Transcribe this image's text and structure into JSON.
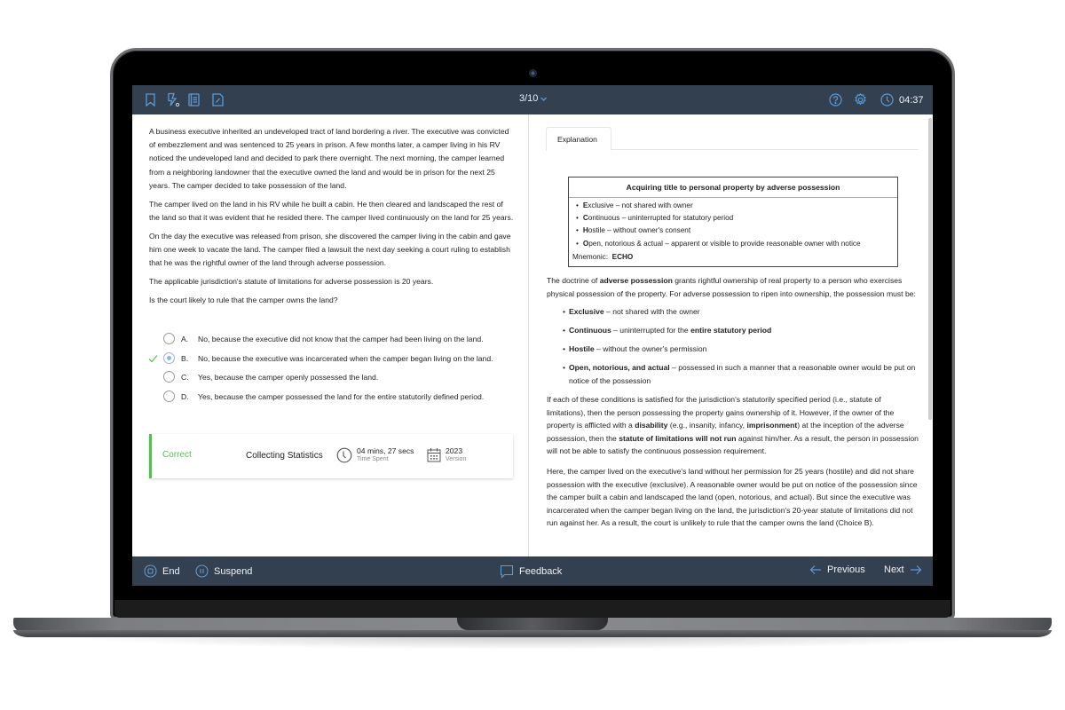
{
  "topbar": {
    "icons": [
      "bookmark-icon",
      "flashcard-icon",
      "notebook-icon",
      "notes-icon"
    ],
    "question_counter": "3/10",
    "timer": "04:37"
  },
  "question": {
    "stem": [
      "A business executive inherited an undeveloped tract of land bordering a river.  The executive was convicted of embezzlement and was sentenced to 25 years in prison.  A few months later, a camper living in his RV noticed the undeveloped land and decided to park there overnight.  The next morning, the camper learned from a neighboring landowner that the executive owned the land and would be in prison for the next 25 years.  The camper decided to take possession of the land.",
      "The camper lived on the land in his RV while he built a cabin.  He then cleared and landscaped the rest of the land so that it was evident that he resided there.  The camper lived continuously on the land for 25 years.",
      "On the day the executive was released from prison, she discovered the camper living in the cabin and gave him one week to vacate the land.  The camper filed a lawsuit the next day seeking a court ruling to establish that he was the rightful owner of the land through adverse possession.",
      "The applicable jurisdiction's statute of limitations for adverse possession is 20 years.",
      "Is the court likely to rule that the camper owns the land?"
    ],
    "choices": [
      {
        "letter": "A.",
        "text": "No, because the executive did not know that the camper had been living on the land.",
        "selected": false,
        "correct": false
      },
      {
        "letter": "B.",
        "text": "No, because the executive was incarcerated when the camper began living on the land.",
        "selected": true,
        "correct": true
      },
      {
        "letter": "C.",
        "text": "Yes, because the camper openly possessed the land.",
        "selected": false,
        "correct": false
      },
      {
        "letter": "D.",
        "text": "Yes, because the camper possessed the land for the entire statutorily defined period.",
        "selected": false,
        "correct": false
      }
    ]
  },
  "result": {
    "status": "Correct",
    "statistics": "Collecting Statistics",
    "time_spent_value": "04 mins, 27 secs",
    "time_spent_label": "Time Spent",
    "version_value": "2023",
    "version_label": "Version"
  },
  "explanation": {
    "tab_label": "Explanation",
    "box": {
      "title": "Acquiring title to personal property by adverse possession",
      "items": [
        {
          "initial": "E",
          "rest": "xclusive – not shared with owner"
        },
        {
          "initial": "C",
          "rest": "ontinuous – uninterrupted for statutory period"
        },
        {
          "initial": "H",
          "rest": "ostile – without owner's consent"
        },
        {
          "initial": "O",
          "rest": "pen, notorious & actual – apparent or visible to provide reasonable owner with notice"
        }
      ],
      "mnemonic_label": "Mnemonic:",
      "mnemonic_value": "ECHO"
    },
    "intro": {
      "before": "The doctrine of ",
      "bold": "adverse possession",
      "after": " grants rightful ownership of real property to a person who exercises physical possession of the property.  For adverse possession to ripen into ownership, the possession must be:"
    },
    "elements": [
      {
        "term": "Exclusive",
        "desc": " – not shared with the owner",
        "bold_tail": ""
      },
      {
        "term": "Continuous",
        "desc": " – uninterrupted for the ",
        "bold_tail": "entire statutory period"
      },
      {
        "term": "Hostile",
        "desc": " – without the owner's permission",
        "bold_tail": ""
      },
      {
        "term": "Open, notorious, and actual",
        "desc": " – possessed in such a manner that a reasonable owner would be put on notice of the possession",
        "bold_tail": ""
      }
    ],
    "para2": {
      "p1": "If each of these conditions is satisfied for the jurisdiction's statutorily specified period (i.e., statute of limitations), then the person possessing the property gains ownership of it.  However, if the owner of the property is afflicted with a ",
      "b1": "disability",
      "p2": " (e.g., insanity, infancy, ",
      "b2": "imprisonment",
      "p3": ") at the inception of the adverse possession, then the ",
      "b3": "statute of limitations will not run",
      "p4": " against him/her.  As a result, the person in possession will not be able to satisfy the continuous possession requirement."
    },
    "para3": "Here, the camper lived on the executive's land without her permission for 25 years (hostile) and did not share possession with the executive (exclusive).  A reasonable owner would be put on notice of the possession since the camper built a cabin and landscaped the land (open, notorious, and actual).  But since the executive was incarcerated when the camper began living on the land, the jurisdiction's 20-year statute of limitations did not run against her.  As a result, the court is unlikely to rule that the camper owns the land (Choice B)."
  },
  "bottombar": {
    "end_label": "End",
    "suspend_label": "Suspend",
    "feedback_label": "Feedback",
    "previous_label": "Previous",
    "next_label": "Next"
  },
  "colors": {
    "bar_bg": "#334050",
    "icon_blue": "#5b9bd5",
    "correct_green": "#5cb85c"
  }
}
